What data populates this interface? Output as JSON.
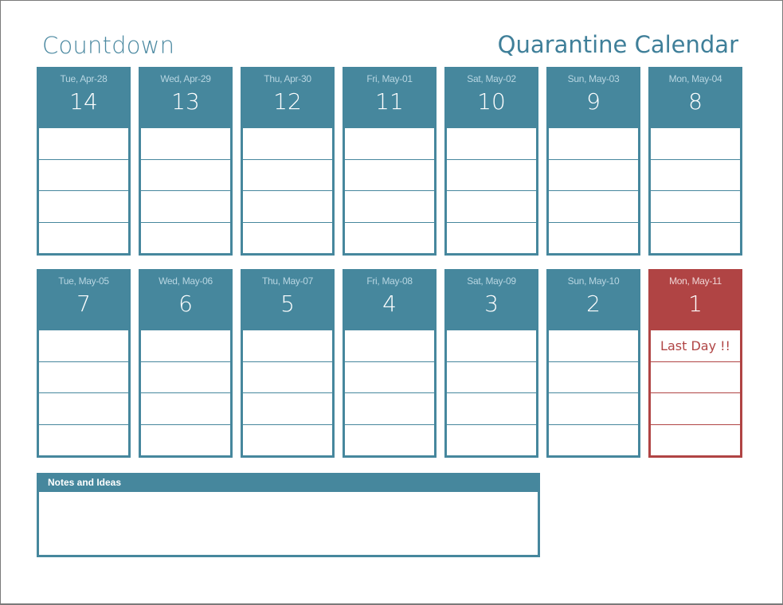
{
  "header": {
    "left_title": "Countdown",
    "right_title": "Quarantine Calendar"
  },
  "colors": {
    "accent": "#46879d",
    "final_day": "#b04444"
  },
  "row1": [
    {
      "date": "Tue, Apr-28",
      "count": "14"
    },
    {
      "date": "Wed, Apr-29",
      "count": "13"
    },
    {
      "date": "Thu, Apr-30",
      "count": "12"
    },
    {
      "date": "Fri, May-01",
      "count": "11"
    },
    {
      "date": "Sat, May-02",
      "count": "10"
    },
    {
      "date": "Sun, May-03",
      "count": "9"
    },
    {
      "date": "Mon, May-04",
      "count": "8"
    }
  ],
  "row2": [
    {
      "date": "Tue, May-05",
      "count": "7"
    },
    {
      "date": "Wed, May-06",
      "count": "6"
    },
    {
      "date": "Thu, May-07",
      "count": "5"
    },
    {
      "date": "Fri, May-08",
      "count": "4"
    },
    {
      "date": "Sat, May-09",
      "count": "3"
    },
    {
      "date": "Sun, May-10",
      "count": "2"
    },
    {
      "date": "Mon, May-11",
      "count": "1",
      "note": "Last Day !!"
    }
  ],
  "notes": {
    "title": "Notes and Ideas",
    "value": ""
  }
}
